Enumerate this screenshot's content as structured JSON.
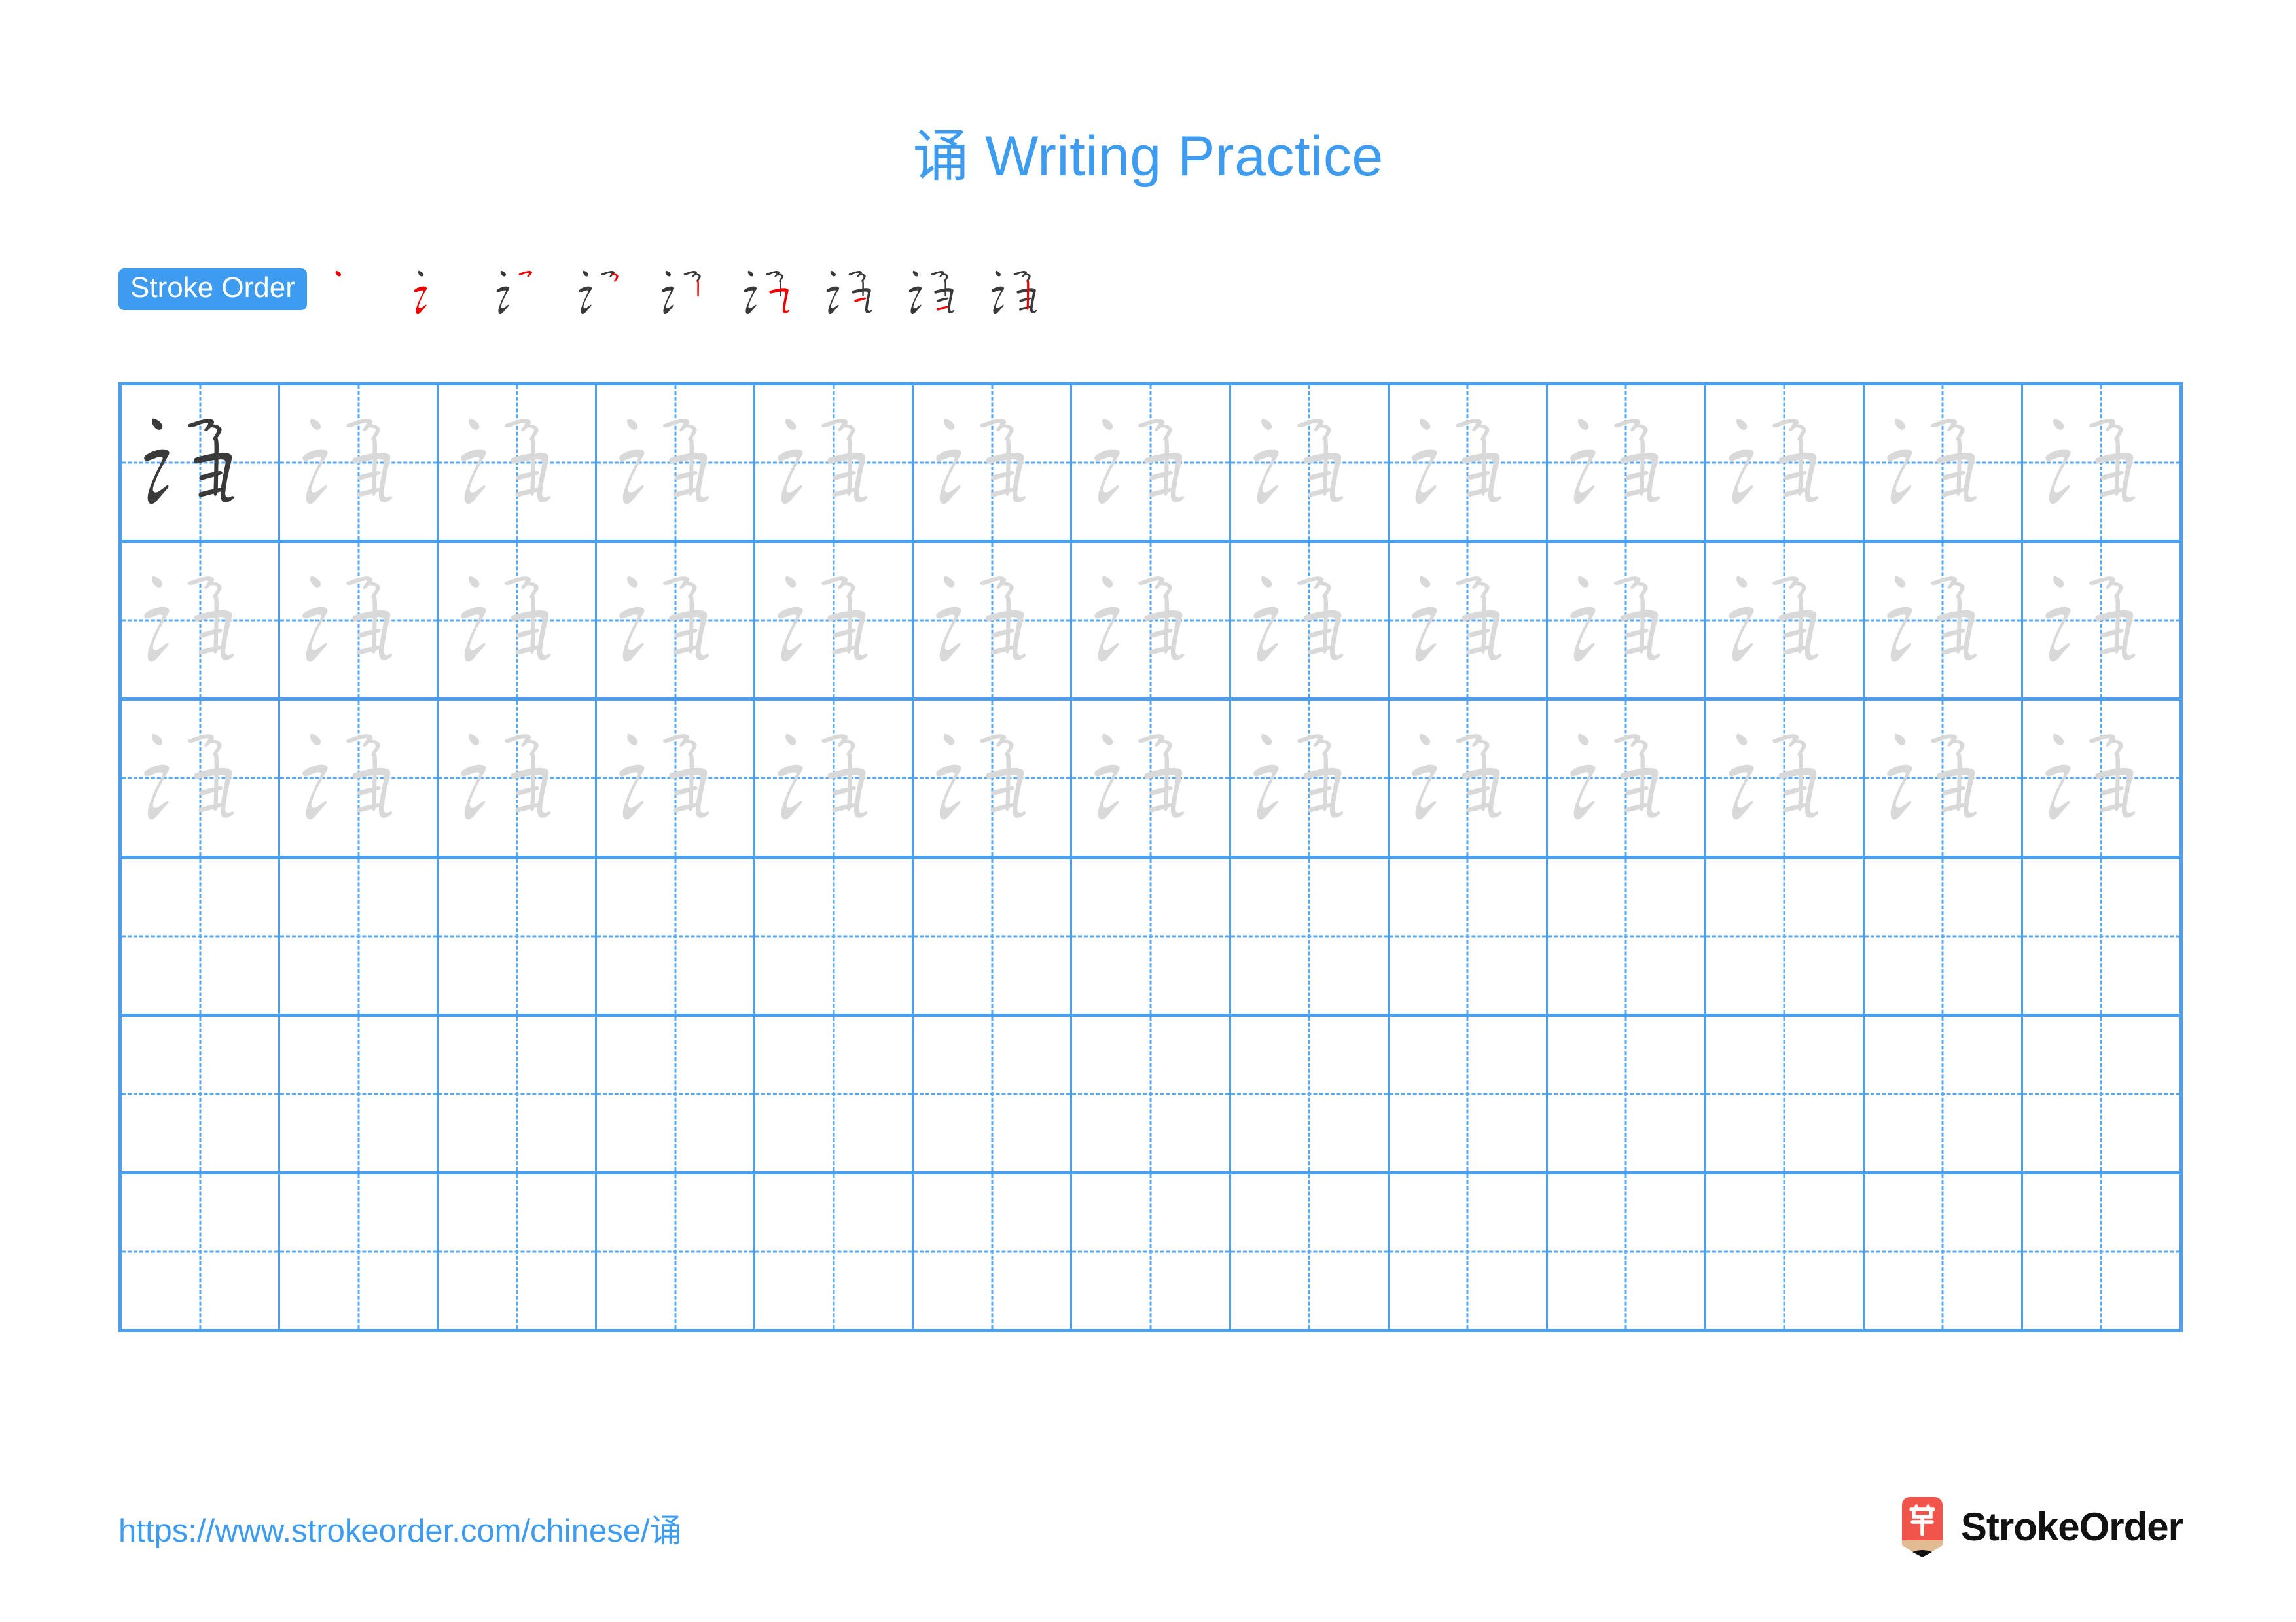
{
  "character": "诵",
  "title": "诵 Writing Practice",
  "colors": {
    "accent_blue": "#3d9bf0",
    "grid_blue": "#4a9ff0",
    "guide_blue": "#58a9f2",
    "stroke_dark": "#3a3a3a",
    "stroke_new_red": "#ee0000",
    "trace_gray": "#d9d9d9",
    "logo_red": "#f1544a",
    "logo_tan": "#e3bb92"
  },
  "stroke_order": {
    "badge_label": "Stroke Order",
    "total_strokes": 9,
    "steps": [
      {
        "index": 1,
        "name": "stroke-step-1",
        "strokes_shown": 1
      },
      {
        "index": 2,
        "name": "stroke-step-2",
        "strokes_shown": 2
      },
      {
        "index": 3,
        "name": "stroke-step-3",
        "strokes_shown": 3
      },
      {
        "index": 4,
        "name": "stroke-step-4",
        "strokes_shown": 4
      },
      {
        "index": 5,
        "name": "stroke-step-5",
        "strokes_shown": 5
      },
      {
        "index": 6,
        "name": "stroke-step-6",
        "strokes_shown": 6
      },
      {
        "index": 7,
        "name": "stroke-step-7",
        "strokes_shown": 7
      },
      {
        "index": 8,
        "name": "stroke-step-8",
        "strokes_shown": 8
      },
      {
        "index": 9,
        "name": "stroke-step-9",
        "strokes_shown": 9
      }
    ]
  },
  "practice_grid": {
    "columns": 13,
    "rows": 6,
    "rows_detail": [
      {
        "row": 1,
        "filled": 13,
        "first_cell_style": "solid"
      },
      {
        "row": 2,
        "filled": 13,
        "first_cell_style": "trace"
      },
      {
        "row": 3,
        "filled": 13,
        "first_cell_style": "trace"
      },
      {
        "row": 4,
        "filled": 0,
        "first_cell_style": "empty"
      },
      {
        "row": 5,
        "filled": 0,
        "first_cell_style": "empty"
      },
      {
        "row": 6,
        "filled": 0,
        "first_cell_style": "empty"
      }
    ]
  },
  "footer": {
    "url": "https://www.strokeorder.com/chinese/诵",
    "brand_name": "StrokeOrder",
    "brand_mark_glyph": "字"
  }
}
